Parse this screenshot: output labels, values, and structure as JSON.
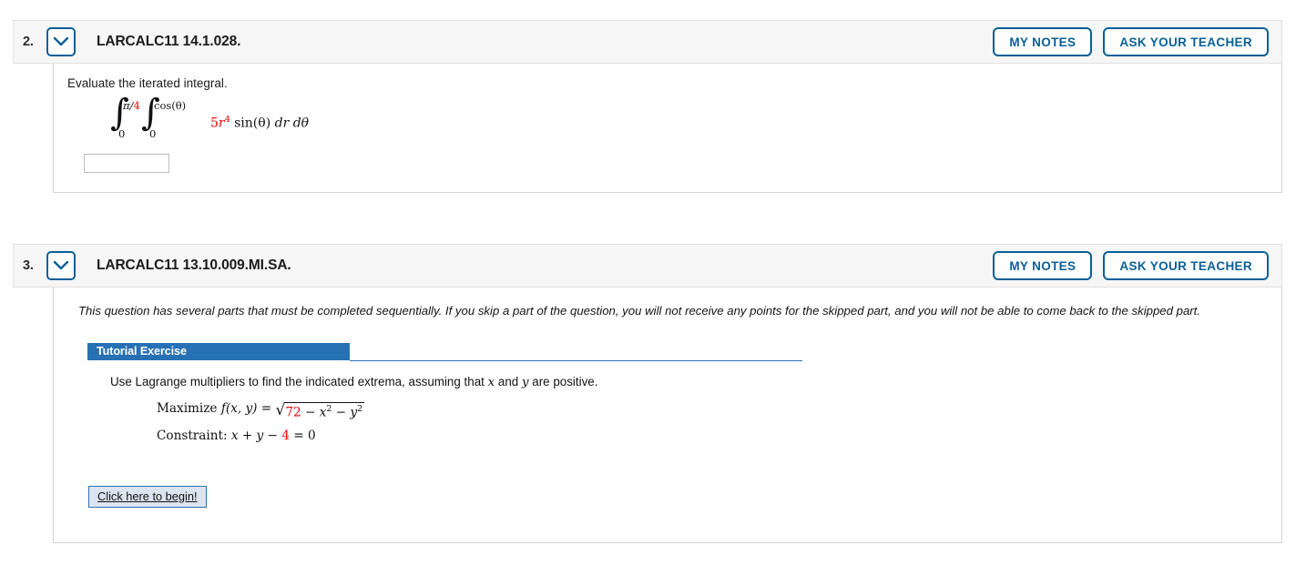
{
  "questions": [
    {
      "number": "2.",
      "code": "LARCALC11 14.1.028.",
      "chevron_icon": "chevron-down-icon",
      "my_notes_label": "MY NOTES",
      "ask_teacher_label": "ASK YOUR TEACHER",
      "prompt": "Evaluate the iterated integral.",
      "integral": {
        "outer_upper_black": "π/",
        "outer_upper_red": "4",
        "outer_lower": "0",
        "inner_upper": "cos(θ)",
        "inner_lower": "0",
        "coefficient_red": "5",
        "variable_red": "r",
        "exponent_red": "4",
        "rest": "sin(θ)",
        "differentials": "dr dθ"
      },
      "answer_value": "",
      "answer_placeholder": ""
    },
    {
      "number": "3.",
      "code": "LARCALC11 13.10.009.MI.SA.",
      "chevron_icon": "chevron-down-icon",
      "my_notes_label": "MY NOTES",
      "ask_teacher_label": "ASK YOUR TEACHER",
      "sequential_note": "This question has several parts that must be completed sequentially. If you skip a part of the question, you will not receive any points for the skipped part, and you will not be able to come back to the skipped part.",
      "tutorial_label": "Tutorial Exercise",
      "instruction_part1": "Use Lagrange multipliers to find the indicated extrema, assuming that ",
      "instruction_x": "x",
      "instruction_part2": " and ",
      "instruction_y": "y",
      "instruction_part3": " are positive.",
      "maximize_label": "Maximize",
      "maximize_fn": "f(x, y)",
      "maximize_eq": "=",
      "radicand_red": "72",
      "radicand_rest_a": " − x",
      "radicand_exp_a": "2",
      "radicand_rest_b": " − y",
      "radicand_exp_b": "2",
      "constraint_label": "Constraint:",
      "constraint_lhs": "x + y − ",
      "constraint_red": "4",
      "constraint_rhs": " = 0",
      "begin_button_label": "Click here to begin!"
    }
  ],
  "colors": {
    "accent_blue": "#0b5f97",
    "banner_blue": "#2770b3",
    "highlight_red": "#ee0000",
    "header_bg": "#f6f6f6",
    "border_gray": "#d4d4d4"
  }
}
